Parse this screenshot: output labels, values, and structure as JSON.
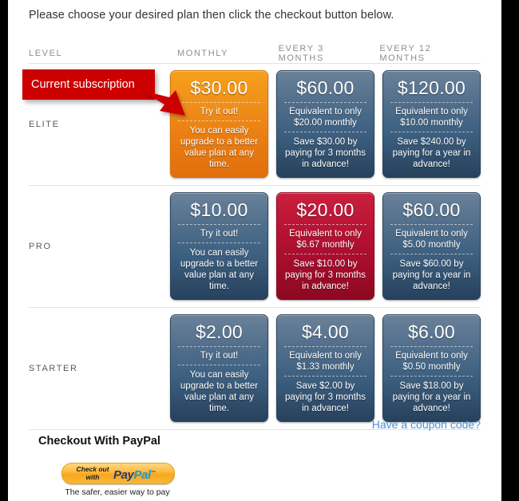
{
  "intro": {
    "text": "Please choose your desired plan then click the checkout button below."
  },
  "table": {
    "headers": {
      "level": "LEVEL",
      "monthly": "MONTHLY",
      "quarterly": "EVERY 3 MONTHS",
      "yearly": "EVERY 12 MONTHS"
    },
    "rows": [
      {
        "level": "ELITE",
        "plans": [
          {
            "price": "$30.00",
            "middle": "Try it out!",
            "bottom": "You can easily upgrade to a better value plan at any time.",
            "style": "orange"
          },
          {
            "price": "$60.00",
            "middle": "Equivalent to only $20.00 monthly",
            "bottom": "Save $30.00 by paying for 3 months in advance!",
            "style": "blue"
          },
          {
            "price": "$120.00",
            "middle": "Equivalent to only $10.00 monthly",
            "bottom": "Save $240.00 by paying for a year in advance!",
            "style": "blue"
          }
        ]
      },
      {
        "level": "PRO",
        "plans": [
          {
            "price": "$10.00",
            "middle": "Try it out!",
            "bottom": "You can easily upgrade to a better value plan at any time.",
            "style": "blue"
          },
          {
            "price": "$20.00",
            "middle": "Equivalent to only $6.67 monthly",
            "bottom": "Save $10.00 by paying for 3 months in advance!",
            "style": "crimson"
          },
          {
            "price": "$60.00",
            "middle": "Equivalent to only $5.00 monthly",
            "bottom": "Save $60.00 by paying for a year in advance!",
            "style": "blue"
          }
        ]
      },
      {
        "level": "STARTER",
        "plans": [
          {
            "price": "$2.00",
            "middle": "Try it out!",
            "bottom": "You can easily upgrade to a better value plan at any time.",
            "style": "blue"
          },
          {
            "price": "$4.00",
            "middle": "Equivalent to only $1.33 monthly",
            "bottom": "Save $2.00 by paying for 3 months in advance!",
            "style": "blue"
          },
          {
            "price": "$6.00",
            "middle": "Equivalent to only $0.50 monthly",
            "bottom": "Save $18.00 by paying for a year in advance!",
            "style": "blue"
          }
        ]
      }
    ]
  },
  "current_subscription": {
    "label": "Current subscription",
    "color": "#cc0000",
    "points_at": "ELITE / MONTHLY"
  },
  "footer": {
    "coupon_link": "Have a coupon code?",
    "checkout_title": "Checkout With PayPal",
    "paypal": {
      "check_out": "Check out",
      "with": "with",
      "pay": "Pay",
      "pal": "Pal",
      "trademark": "™",
      "tagline": "The safer, easier way to pay"
    }
  },
  "colors": {
    "accent_orange": "#ea7c12",
    "accent_blue": "#3c5f80",
    "accent_crimson": "#a50c2c",
    "link_blue": "#4a90d9",
    "banner_red": "#cc0000"
  }
}
